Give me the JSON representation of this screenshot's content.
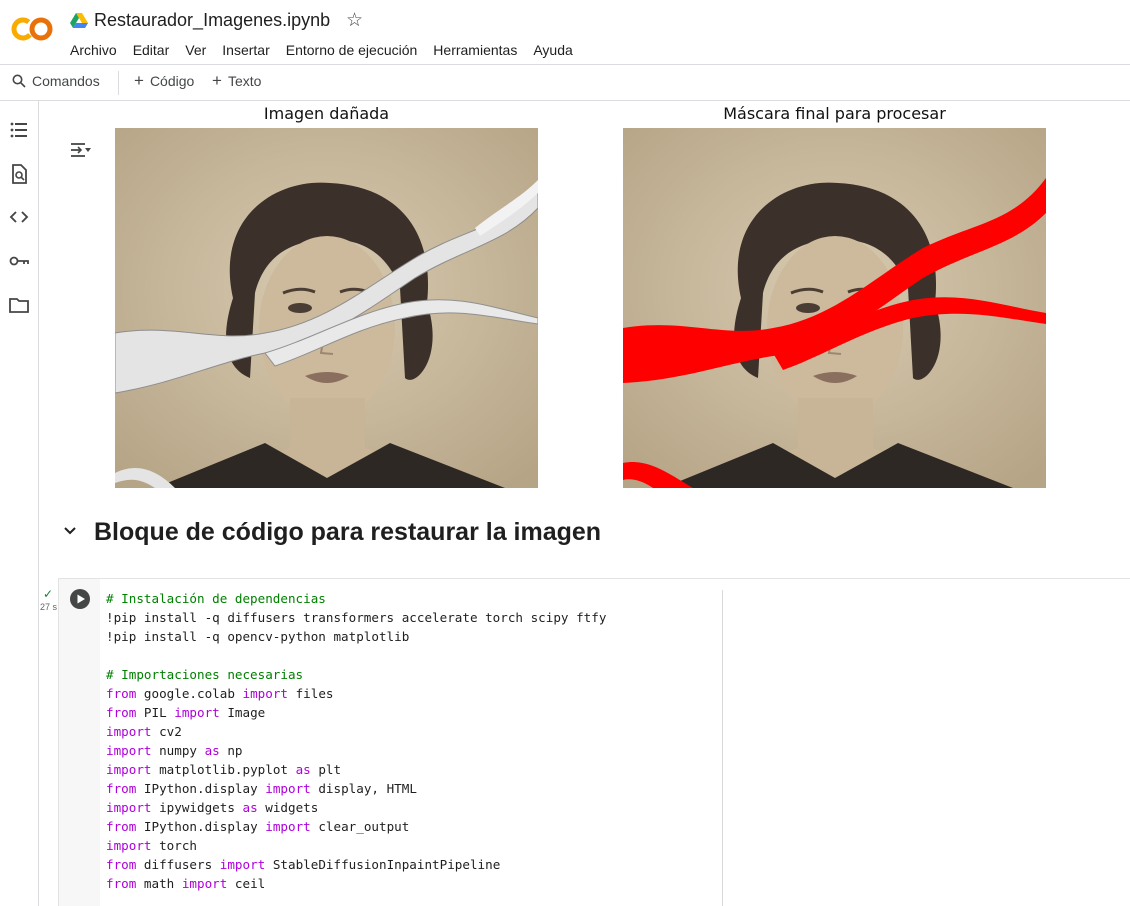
{
  "app": {
    "logo_text": "CO",
    "notebook_title": "Restaurador_Imagenes.ipynb"
  },
  "menu": [
    "Archivo",
    "Editar",
    "Ver",
    "Insertar",
    "Entorno de ejecución",
    "Herramientas",
    "Ayuda"
  ],
  "toolbar": {
    "commands_label": "Comandos",
    "add_code_label": "Código",
    "add_text_label": "Texto"
  },
  "sidebar_icons": [
    "table-of-contents-icon",
    "find-replace-icon",
    "code-snippets-icon",
    "secrets-key-icon",
    "files-folder-icon"
  ],
  "output": {
    "damaged_title": "Imagen dañada",
    "mask_title": "Máscara final para procesar"
  },
  "section": {
    "heading": "Bloque de código para restaurar la imagen"
  },
  "cell": {
    "status": "✓",
    "exec_time": "27 s",
    "lines": [
      [
        {
          "t": "c",
          "v": "# Instalación de dependencias"
        }
      ],
      [
        {
          "t": "p",
          "v": "!pip install -q diffusers transformers accelerate torch scipy ftfy"
        }
      ],
      [
        {
          "t": "p",
          "v": "!pip install -q opencv-python matplotlib"
        }
      ],
      [],
      [
        {
          "t": "c",
          "v": "# Importaciones necesarias"
        }
      ],
      [
        {
          "t": "k",
          "v": "from"
        },
        {
          "t": "p",
          "v": " google.colab "
        },
        {
          "t": "k",
          "v": "import"
        },
        {
          "t": "p",
          "v": " files"
        }
      ],
      [
        {
          "t": "k",
          "v": "from"
        },
        {
          "t": "p",
          "v": " PIL "
        },
        {
          "t": "k",
          "v": "import"
        },
        {
          "t": "p",
          "v": " Image"
        }
      ],
      [
        {
          "t": "k",
          "v": "import"
        },
        {
          "t": "p",
          "v": " cv2"
        }
      ],
      [
        {
          "t": "k",
          "v": "import"
        },
        {
          "t": "p",
          "v": " numpy "
        },
        {
          "t": "k",
          "v": "as"
        },
        {
          "t": "p",
          "v": " np"
        }
      ],
      [
        {
          "t": "k",
          "v": "import"
        },
        {
          "t": "p",
          "v": " matplotlib.pyplot "
        },
        {
          "t": "k",
          "v": "as"
        },
        {
          "t": "p",
          "v": " plt"
        }
      ],
      [
        {
          "t": "k",
          "v": "from"
        },
        {
          "t": "p",
          "v": " IPython.display "
        },
        {
          "t": "k",
          "v": "import"
        },
        {
          "t": "p",
          "v": " display, HTML"
        }
      ],
      [
        {
          "t": "k",
          "v": "import"
        },
        {
          "t": "p",
          "v": " ipywidgets "
        },
        {
          "t": "k",
          "v": "as"
        },
        {
          "t": "p",
          "v": " widgets"
        }
      ],
      [
        {
          "t": "k",
          "v": "from"
        },
        {
          "t": "p",
          "v": " IPython.display "
        },
        {
          "t": "k",
          "v": "import"
        },
        {
          "t": "p",
          "v": " clear_output"
        }
      ],
      [
        {
          "t": "k",
          "v": "import"
        },
        {
          "t": "p",
          "v": " torch"
        }
      ],
      [
        {
          "t": "k",
          "v": "from"
        },
        {
          "t": "p",
          "v": " diffusers "
        },
        {
          "t": "k",
          "v": "import"
        },
        {
          "t": "p",
          "v": " StableDiffusionInpaintPipeline"
        }
      ],
      [
        {
          "t": "k",
          "v": "from"
        },
        {
          "t": "p",
          "v": " math "
        },
        {
          "t": "k",
          "v": "import"
        },
        {
          "t": "p",
          "v": " ceil"
        }
      ]
    ]
  },
  "colors": {
    "logo_orange": "#f9ab00",
    "mask_red": "#ff0000",
    "sepia_bg": "#cfc1a6",
    "comment": "#008000",
    "keyword": "#af00db"
  }
}
